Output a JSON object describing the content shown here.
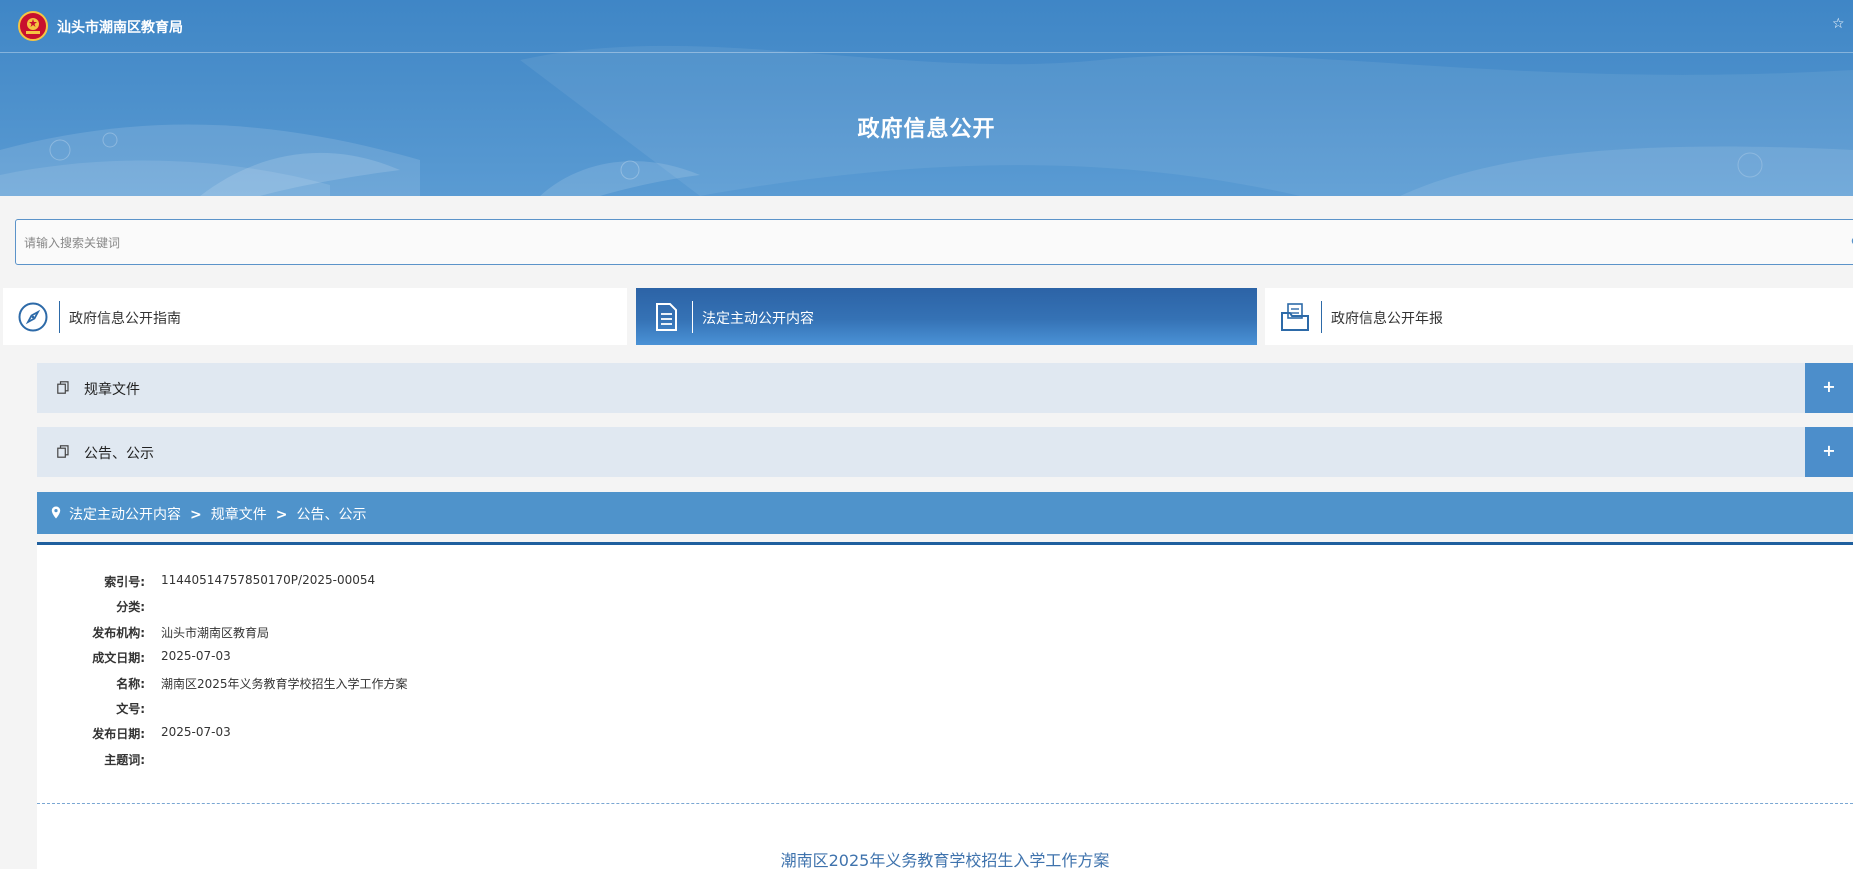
{
  "header": {
    "site_name": "汕头市潮南区教育局",
    "page_title": "政府信息公开",
    "emblem_icon": "national-emblem-icon",
    "favorite_icon": "star-icon"
  },
  "search": {
    "placeholder": "请输入搜索关键词",
    "icon": "search-icon"
  },
  "nav_tabs": [
    {
      "label": "政府信息公开指南",
      "icon": "compass-icon",
      "active": false
    },
    {
      "label": "法定主动公开内容",
      "icon": "document-icon",
      "active": true
    },
    {
      "label": "政府信息公开年报",
      "icon": "folder-icon",
      "active": false
    }
  ],
  "accordion": [
    {
      "label": "规章文件",
      "toggle": "+"
    },
    {
      "label": "公告、公示",
      "toggle": "+"
    }
  ],
  "breadcrumb": {
    "items": [
      "法定主动公开内容",
      "规章文件",
      "公告、公示"
    ],
    "separator": "〉"
  },
  "meta": [
    {
      "key": "索引号:",
      "value": "11440514757850170P/2025-00054"
    },
    {
      "key": "分类:",
      "value": ""
    },
    {
      "key": "发布机构:",
      "value": "汕头市潮南区教育局"
    },
    {
      "key": "成文日期:",
      "value": "2025-07-03"
    },
    {
      "key": "名称:",
      "value": "潮南区2025年义务教育学校招生入学工作方案"
    },
    {
      "key": "文号:",
      "value": ""
    },
    {
      "key": "发布日期:",
      "value": "2025-07-03"
    },
    {
      "key": "主题词:",
      "value": ""
    }
  ],
  "document": {
    "title": "潮南区2025年义务教育学校招生入学工作方案"
  },
  "colors": {
    "primary": "#4f93cb",
    "active_tab": "#2c63a6",
    "accordion_bg": "#e0e8f1",
    "panel_border": "#1f5f9e"
  }
}
